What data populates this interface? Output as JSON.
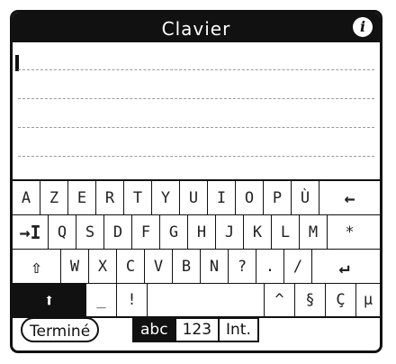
{
  "title": "Clavier",
  "info_icon": "info-icon",
  "text_area": {
    "value": "",
    "lines": 5
  },
  "keyboard": {
    "row1": [
      "A",
      "Z",
      "E",
      "R",
      "T",
      "Y",
      "U",
      "I",
      "O",
      "P",
      "Ù",
      "←"
    ],
    "row2": [
      "→I",
      "Q",
      "S",
      "D",
      "F",
      "G",
      "H",
      "J",
      "K",
      "L",
      "M",
      "*"
    ],
    "row3": [
      "⇧",
      "W",
      "X",
      "C",
      "V",
      "B",
      "N",
      "?",
      ".",
      "/",
      "↵"
    ],
    "row4": [
      "⬆",
      "_",
      "!",
      " ",
      "^",
      "§",
      "Ç",
      "µ"
    ]
  },
  "bottom": {
    "done_label": "Terminé",
    "modes": [
      {
        "label": "abc",
        "active": true
      },
      {
        "label": "123",
        "active": false
      },
      {
        "label": "Int.",
        "active": false
      }
    ]
  },
  "colors": {
    "dark": "#111111",
    "background": "#ffffff",
    "dotted_line": "#9a9a9a"
  }
}
